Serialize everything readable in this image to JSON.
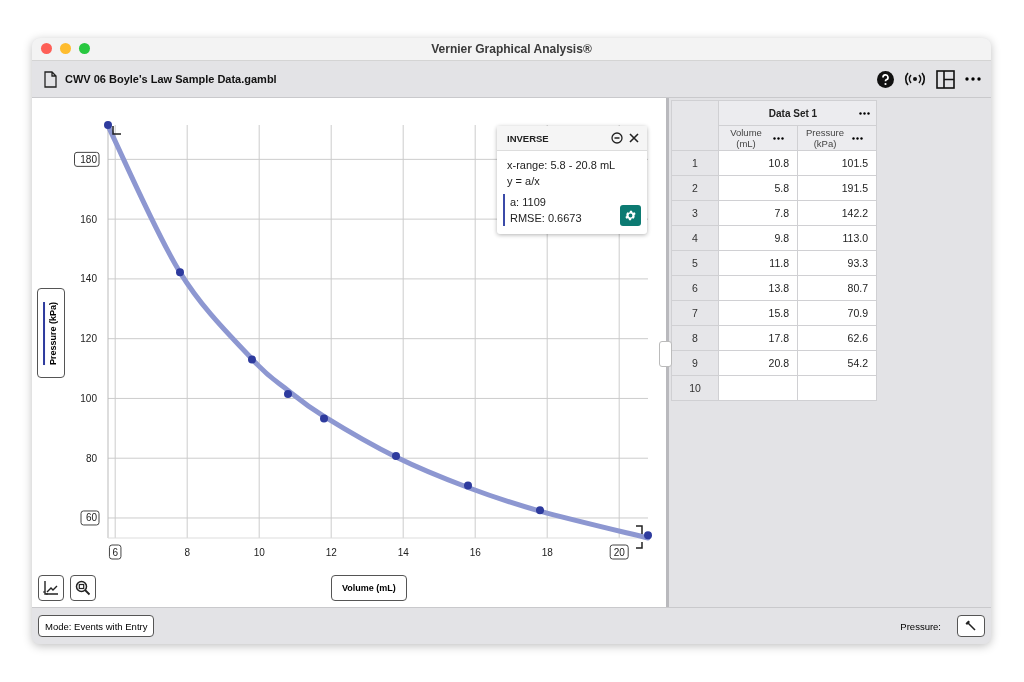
{
  "window": {
    "title": "Vernier Graphical Analysis®"
  },
  "toolbar": {
    "file_name": "CWV 06 Boyle's Law Sample Data.gambl"
  },
  "graph": {
    "chart_data": {
      "type": "scatter",
      "grid": true,
      "xlabel": "Volume (mL)",
      "x": [
        5.8,
        7.8,
        9.8,
        10.8,
        11.8,
        13.8,
        15.8,
        17.8,
        20.8
      ],
      "series": [
        {
          "name": "Pressure (kPa)",
          "color": "#2e3b9e",
          "values": [
            191.5,
            142.2,
            113.0,
            101.5,
            93.3,
            80.7,
            70.9,
            62.6,
            54.2
          ]
        },
        {
          "name": "INVERSE",
          "type": "line",
          "color": "#8d97d1",
          "values": [
            191.2,
            142.2,
            113.2,
            102.7,
            94.0,
            80.4,
            70.2,
            62.3,
            53.3
          ]
        }
      ],
      "xlim": [
        5.8,
        20.8
      ],
      "ylim": [
        53.3,
        191.5
      ],
      "xticks": [
        6,
        8,
        10,
        12,
        14,
        16,
        18,
        20
      ],
      "yticks": [
        60,
        80,
        100,
        120,
        140,
        160,
        180
      ]
    },
    "curve_fit": {
      "lines": [
        "x-range: 5.8 - 20.8 mL",
        "y = a/x"
      ],
      "parameters": [
        "a: 1109",
        "RMSE: 0.6673"
      ]
    }
  },
  "table": {
    "data_set": "Data Set 1",
    "columns": [
      "Volume (mL)",
      "Pressure (kPa)"
    ],
    "rows": [
      {
        "number": "1",
        "cells": [
          "10.8",
          "101.5"
        ]
      },
      {
        "number": "2",
        "cells": [
          "5.8",
          "191.5"
        ]
      },
      {
        "number": "3",
        "cells": [
          "7.8",
          "142.2"
        ]
      },
      {
        "number": "4",
        "cells": [
          "9.8",
          "113.0"
        ]
      },
      {
        "number": "5",
        "cells": [
          "11.8",
          "93.3"
        ]
      },
      {
        "number": "6",
        "cells": [
          "13.8",
          "80.7"
        ]
      },
      {
        "number": "7",
        "cells": [
          "15.8",
          "70.9"
        ]
      },
      {
        "number": "8",
        "cells": [
          "17.8",
          "62.6"
        ]
      },
      {
        "number": "9",
        "cells": [
          "20.8",
          "54.2"
        ]
      },
      {
        "number": "10",
        "cells": []
      }
    ]
  },
  "status_bar": {
    "mode": "Mode: Events with Entry",
    "sensor_label": "Pressure:"
  }
}
